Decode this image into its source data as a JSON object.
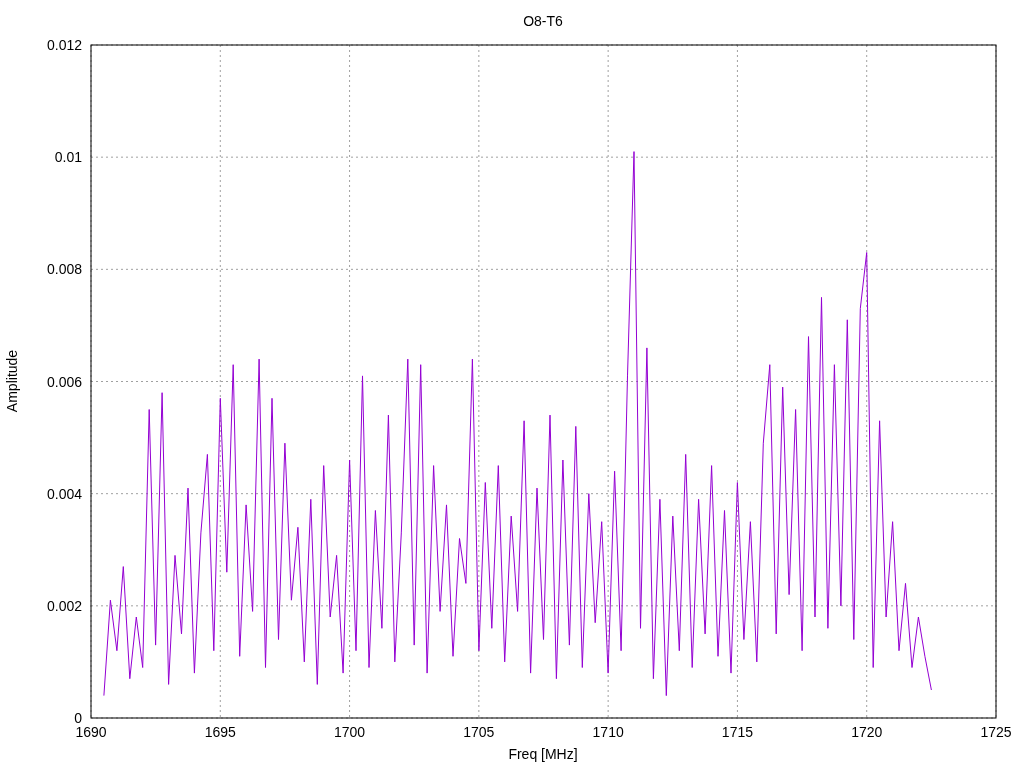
{
  "plot": {
    "chart_data": {
      "type": "line",
      "title": "O8-T6",
      "xlabel": "Freq [MHz]",
      "ylabel": "Amplitude",
      "grid": true,
      "xlim": [
        1690,
        1725
      ],
      "ylim": [
        0,
        0.012
      ],
      "xticks": [
        1690,
        1695,
        1700,
        1705,
        1710,
        1715,
        1720,
        1725
      ],
      "yticks": [
        0,
        0.002,
        0.004,
        0.006,
        0.008,
        0.01,
        0.012
      ],
      "x": [
        1690.5,
        1690.75,
        1691,
        1691.25,
        1691.5,
        1691.75,
        1692,
        1692.25,
        1692.5,
        1692.75,
        1693,
        1693.25,
        1693.5,
        1693.75,
        1694,
        1694.25,
        1694.5,
        1694.75,
        1695,
        1695.25,
        1695.5,
        1695.75,
        1696,
        1696.25,
        1696.5,
        1696.75,
        1697,
        1697.25,
        1697.5,
        1697.75,
        1698,
        1698.25,
        1698.5,
        1698.75,
        1699,
        1699.25,
        1699.5,
        1699.75,
        1700,
        1700.25,
        1700.5,
        1700.75,
        1701,
        1701.25,
        1701.5,
        1701.75,
        1702,
        1702.25,
        1702.5,
        1702.75,
        1703,
        1703.25,
        1703.5,
        1703.75,
        1704,
        1704.25,
        1704.5,
        1704.75,
        1705,
        1705.25,
        1705.5,
        1705.75,
        1706,
        1706.25,
        1706.5,
        1706.75,
        1707,
        1707.25,
        1707.5,
        1707.75,
        1708,
        1708.25,
        1708.5,
        1708.75,
        1709,
        1709.25,
        1709.5,
        1709.75,
        1710,
        1710.25,
        1710.5,
        1710.75,
        1711,
        1711.25,
        1711.5,
        1711.75,
        1712,
        1712.25,
        1712.5,
        1712.75,
        1713,
        1713.25,
        1713.5,
        1713.75,
        1714,
        1714.25,
        1714.5,
        1714.75,
        1715,
        1715.25,
        1715.5,
        1715.75,
        1716,
        1716.25,
        1716.5,
        1716.75,
        1717,
        1717.25,
        1717.5,
        1717.75,
        1718,
        1718.25,
        1718.5,
        1718.75,
        1719,
        1719.25,
        1719.5,
        1719.75,
        1720,
        1720.25,
        1720.5,
        1720.75,
        1721,
        1721.25,
        1721.5,
        1721.75,
        1722,
        1722.25,
        1722.5
      ],
      "series": [
        {
          "color": "#9400d3",
          "values": [
            0.0004,
            0.0021,
            0.0012,
            0.0027,
            0.0007,
            0.0018,
            0.0009,
            0.0055,
            0.0013,
            0.0058,
            0.0006,
            0.0029,
            0.0015,
            0.0041,
            0.0008,
            0.0033,
            0.0047,
            0.0012,
            0.0057,
            0.0026,
            0.0063,
            0.0011,
            0.0038,
            0.0019,
            0.0064,
            0.0009,
            0.0057,
            0.0014,
            0.0049,
            0.0021,
            0.0034,
            0.001,
            0.0039,
            0.0006,
            0.0045,
            0.0018,
            0.0029,
            0.0008,
            0.0046,
            0.0012,
            0.0061,
            0.0009,
            0.0037,
            0.0016,
            0.0054,
            0.001,
            0.0033,
            0.0064,
            0.0013,
            0.0063,
            0.0008,
            0.0045,
            0.0019,
            0.0038,
            0.0011,
            0.0032,
            0.0024,
            0.0064,
            0.0012,
            0.0042,
            0.0016,
            0.0045,
            0.001,
            0.0036,
            0.0019,
            0.0053,
            0.0008,
            0.0041,
            0.0014,
            0.0054,
            0.0007,
            0.0046,
            0.0013,
            0.0052,
            0.0009,
            0.004,
            0.0017,
            0.0035,
            0.0008,
            0.0044,
            0.0012,
            0.0061,
            0.0101,
            0.0016,
            0.0066,
            0.0007,
            0.0039,
            0.0004,
            0.0036,
            0.0012,
            0.0047,
            0.0009,
            0.0039,
            0.0015,
            0.0045,
            0.0011,
            0.0037,
            0.0008,
            0.0042,
            0.0014,
            0.0035,
            0.001,
            0.0049,
            0.0063,
            0.0015,
            0.0059,
            0.0022,
            0.0055,
            0.0012,
            0.0068,
            0.0018,
            0.0075,
            0.0016,
            0.0063,
            0.002,
            0.0071,
            0.0014,
            0.0073,
            0.0083,
            0.0009,
            0.0053,
            0.0018,
            0.0035,
            0.0012,
            0.0024,
            0.0009,
            0.0018,
            0.0011,
            0.0005
          ]
        }
      ]
    }
  }
}
